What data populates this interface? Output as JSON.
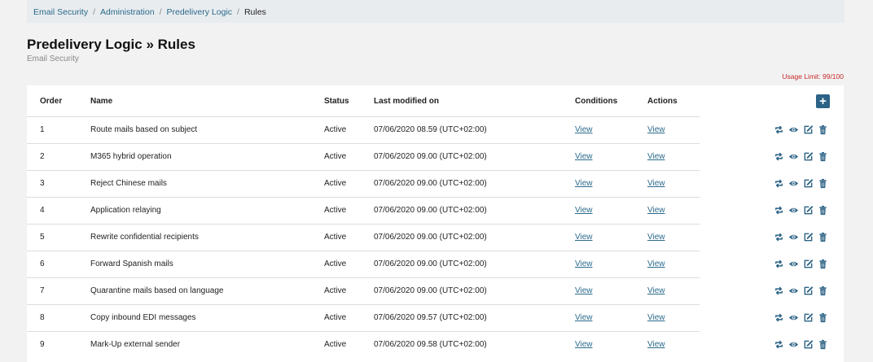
{
  "breadcrumb": {
    "items": [
      "Email Security",
      "Administration",
      "Predelivery Logic"
    ],
    "current": "Rules"
  },
  "page": {
    "title": "Predelivery Logic » Rules",
    "subtitle": "Email Security",
    "usage_limit": "Usage Limit: 99/100"
  },
  "colors": {
    "accent": "#2b6285",
    "link": "#2a6a8c",
    "warning": "#c62828"
  },
  "table": {
    "headers": {
      "order": "Order",
      "name": "Name",
      "status": "Status",
      "modified": "Last modified on",
      "conditions": "Conditions",
      "actions": "Actions"
    },
    "add_icon": "plus-icon",
    "row_icons": [
      "repeat-icon",
      "eye-icon",
      "edit-icon",
      "trash-icon"
    ],
    "rows": [
      {
        "order": "1",
        "name": "Route mails based on subject",
        "status": "Active",
        "modified": "07/06/2020 08.59 (UTC+02:00)",
        "conditions": "View",
        "actions": "View"
      },
      {
        "order": "2",
        "name": "M365 hybrid operation",
        "status": "Active",
        "modified": "07/06/2020 09.00 (UTC+02:00)",
        "conditions": "View",
        "actions": "View"
      },
      {
        "order": "3",
        "name": "Reject Chinese mails",
        "status": "Active",
        "modified": "07/06/2020 09.00 (UTC+02:00)",
        "conditions": "View",
        "actions": "View"
      },
      {
        "order": "4",
        "name": "Application relaying",
        "status": "Active",
        "modified": "07/06/2020 09.00 (UTC+02:00)",
        "conditions": "View",
        "actions": "View"
      },
      {
        "order": "5",
        "name": "Rewrite confidential recipients",
        "status": "Active",
        "modified": "07/06/2020 09.00 (UTC+02:00)",
        "conditions": "View",
        "actions": "View"
      },
      {
        "order": "6",
        "name": "Forward Spanish mails",
        "status": "Active",
        "modified": "07/06/2020 09.00 (UTC+02:00)",
        "conditions": "View",
        "actions": "View"
      },
      {
        "order": "7",
        "name": "Quarantine mails based on language",
        "status": "Active",
        "modified": "07/06/2020 09.00 (UTC+02:00)",
        "conditions": "View",
        "actions": "View"
      },
      {
        "order": "8",
        "name": "Copy inbound EDI messages",
        "status": "Active",
        "modified": "07/06/2020 09.57 (UTC+02:00)",
        "conditions": "View",
        "actions": "View"
      },
      {
        "order": "9",
        "name": "Mark-Up external sender",
        "status": "Active",
        "modified": "07/06/2020 09.58 (UTC+02:00)",
        "conditions": "View",
        "actions": "View"
      }
    ]
  }
}
